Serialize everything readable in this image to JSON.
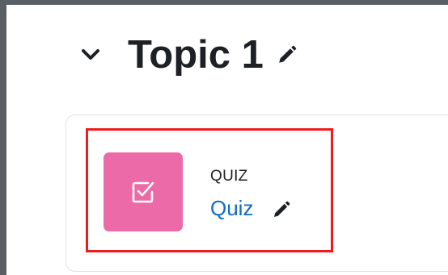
{
  "section": {
    "title": "Topic 1",
    "collapse_icon": "chevron-down-icon",
    "edit_icon": "pencil-icon"
  },
  "activity": {
    "type_label": "QUIZ",
    "name": "Quiz",
    "icon": "quiz-checkbox-icon",
    "edit_icon": "pencil-icon"
  },
  "colors": {
    "quiz_tile": "#ec6aa7",
    "link": "#0f6cbf",
    "highlight": "#ee1c1c",
    "frame": "#5a5f66"
  }
}
